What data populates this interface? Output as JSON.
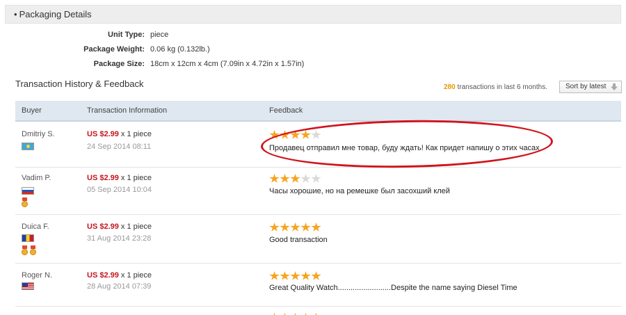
{
  "packaging": {
    "header": "Packaging Details",
    "bullet": "•",
    "specs": [
      {
        "label": "Unit Type:",
        "value": "piece"
      },
      {
        "label": "Package Weight:",
        "value": "0.06 kg (0.132lb.)"
      },
      {
        "label": "Package Size:",
        "value": "18cm x 12cm x 4cm (7.09in x 4.72in x 1.57in)"
      }
    ]
  },
  "transactions": {
    "title": "Transaction History & Feedback",
    "count": "280",
    "count_suffix": " transactions in last 6 months.",
    "sort_label": "Sort by latest",
    "columns": {
      "buyer": "Buyer",
      "info": "Transaction Information",
      "feedback": "Feedback"
    },
    "rows": [
      {
        "buyer": "Dmitriy S.",
        "flag": "kazakhstan-flag",
        "medals": 0,
        "price": "US $2.99",
        "qty": " x 1 piece",
        "date": "24 Sep 2014 08:11",
        "rating": 4,
        "feedback": "Продавец отправил мне товар, буду ждать! Как придет напишу о этих часах"
      },
      {
        "buyer": "Vadim P.",
        "flag": "russia-flag",
        "medals": 1,
        "price": "US $2.99",
        "qty": " x 1 piece",
        "date": "05 Sep 2014 10:04",
        "rating": 3,
        "feedback": "Часы хорошие, но на ремешке был засохший клей"
      },
      {
        "buyer": "Duica F.",
        "flag": "romania-flag",
        "medals": 2,
        "price": "US $2.99",
        "qty": " x 1 piece",
        "date": "31 Aug 2014 23:28",
        "rating": 5,
        "feedback": "Good transaction"
      },
      {
        "buyer": "Roger N.",
        "flag": "usa-flag",
        "medals": 0,
        "price": "US $2.99",
        "qty": " x 1 piece",
        "date": "28 Aug 2014 07:39",
        "rating": 5,
        "feedback": "Great Quality Watch.........................Despite the name saying Diesel Time"
      }
    ]
  },
  "colors": {
    "price_red": "#c4161c",
    "star_orange": "#f6a420",
    "count_orange": "#e89700",
    "annotation_red": "#d0151d",
    "table_header_bg": "#dfe7f1"
  }
}
